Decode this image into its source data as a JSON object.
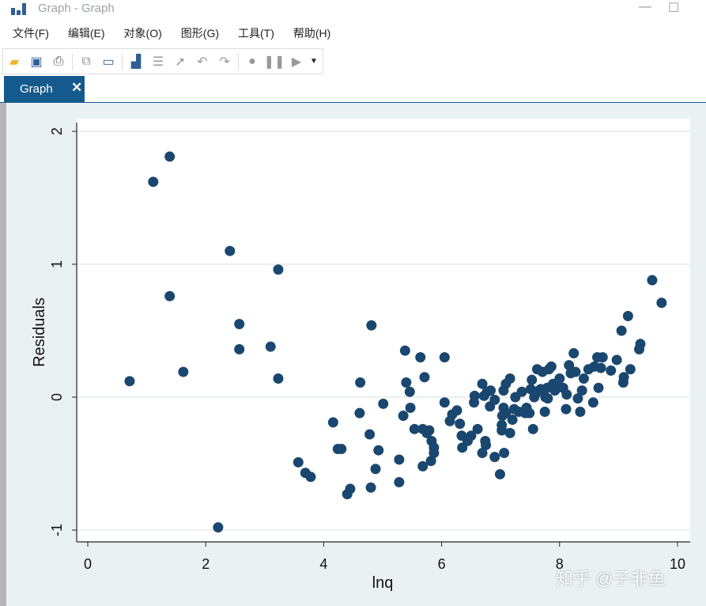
{
  "window": {
    "title": "Graph - Graph"
  },
  "menu": [
    "文件(F)",
    "编辑(E)",
    "对象(O)",
    "图形(G)",
    "工具(T)",
    "帮助(H)"
  ],
  "toolbar_icons": [
    "open-icon",
    "save-icon",
    "print-icon",
    "copy-icon",
    "rename-icon",
    "graph-editor-icon",
    "properties-icon",
    "pointer-icon",
    "undo-icon",
    "redo-icon",
    "record-icon",
    "pause-icon",
    "play-icon",
    "dropdown-icon"
  ],
  "tab": {
    "label": "Graph",
    "close": "✕"
  },
  "watermark": "知乎 @子非鱼",
  "colors": {
    "marker": "#1a476f",
    "plot_bg": "#ffffff",
    "outer_bg": "#eaf1f3",
    "tab": "#145a8c"
  },
  "chart_data": {
    "type": "scatter",
    "xlabel": "lnq",
    "ylabel": "Residuals",
    "xlim": [
      -0.2,
      10.2
    ],
    "ylim": [
      -1.1,
      2.1
    ],
    "xticks": [
      0,
      2,
      4,
      6,
      8,
      10
    ],
    "yticks": [
      -1,
      0,
      1,
      2
    ],
    "grid": "horizontal",
    "points": [
      [
        0.71,
        0.12
      ],
      [
        1.11,
        1.62
      ],
      [
        1.39,
        1.81
      ],
      [
        1.39,
        0.76
      ],
      [
        1.62,
        0.19
      ],
      [
        2.21,
        -0.98
      ],
      [
        2.41,
        1.1
      ],
      [
        2.57,
        0.55
      ],
      [
        2.57,
        0.36
      ],
      [
        3.1,
        0.38
      ],
      [
        3.23,
        0.96
      ],
      [
        3.23,
        0.14
      ],
      [
        3.57,
        -0.49
      ],
      [
        3.69,
        -0.57
      ],
      [
        3.78,
        -0.6
      ],
      [
        4.16,
        -0.19
      ],
      [
        4.24,
        -0.39
      ],
      [
        4.3,
        -0.39
      ],
      [
        4.4,
        -0.73
      ],
      [
        4.45,
        -0.69
      ],
      [
        4.61,
        -0.12
      ],
      [
        4.62,
        0.11
      ],
      [
        4.78,
        -0.28
      ],
      [
        4.8,
        -0.68
      ],
      [
        4.81,
        0.54
      ],
      [
        4.88,
        -0.54
      ],
      [
        4.93,
        -0.4
      ],
      [
        5.01,
        -0.05
      ],
      [
        5.28,
        -0.47
      ],
      [
        5.28,
        -0.64
      ],
      [
        5.35,
        -0.14
      ],
      [
        5.38,
        0.35
      ],
      [
        5.4,
        0.11
      ],
      [
        5.46,
        0.04
      ],
      [
        5.47,
        -0.08
      ],
      [
        5.54,
        -0.24
      ],
      [
        5.64,
        0.3
      ],
      [
        5.68,
        -0.24
      ],
      [
        5.68,
        -0.52
      ],
      [
        5.71,
        0.15
      ],
      [
        5.75,
        -0.27
      ],
      [
        5.79,
        -0.25
      ],
      [
        5.82,
        -0.48
      ],
      [
        5.83,
        -0.33
      ],
      [
        5.87,
        -0.38
      ],
      [
        5.87,
        -0.42
      ],
      [
        6.05,
        0.3
      ],
      [
        6.05,
        -0.04
      ],
      [
        6.14,
        -0.18
      ],
      [
        6.18,
        -0.13
      ],
      [
        6.26,
        -0.1
      ],
      [
        6.31,
        -0.2
      ],
      [
        6.34,
        -0.29
      ],
      [
        6.35,
        -0.38
      ],
      [
        6.44,
        -0.33
      ],
      [
        6.5,
        -0.29
      ],
      [
        6.55,
        -0.04
      ],
      [
        6.56,
        0.01
      ],
      [
        6.61,
        -0.24
      ],
      [
        6.69,
        0.1
      ],
      [
        6.69,
        -0.42
      ],
      [
        6.72,
        0.01
      ],
      [
        6.74,
        -0.33
      ],
      [
        6.75,
        -0.36
      ],
      [
        6.77,
        0.04
      ],
      [
        6.82,
        -0.07
      ],
      [
        6.83,
        0.05
      ],
      [
        6.9,
        -0.45
      ],
      [
        6.9,
        -0.02
      ],
      [
        6.99,
        -0.58
      ],
      [
        7.02,
        -0.25
      ],
      [
        7.02,
        -0.21
      ],
      [
        7.03,
        -0.14
      ],
      [
        7.05,
        -0.08
      ],
      [
        7.06,
        -0.42
      ],
      [
        7.05,
        0.05
      ],
      [
        7.09,
        0.1
      ],
      [
        7.09,
        -0.12
      ],
      [
        7.16,
        -0.27
      ],
      [
        7.16,
        0.14
      ],
      [
        7.2,
        -0.17
      ],
      [
        7.23,
        -0.09
      ],
      [
        7.25,
        0.0
      ],
      [
        7.31,
        -0.11
      ],
      [
        7.36,
        0.04
      ],
      [
        7.42,
        -0.12
      ],
      [
        7.44,
        -0.08
      ],
      [
        7.49,
        -0.12
      ],
      [
        7.51,
        0.06
      ],
      [
        7.53,
        0.13
      ],
      [
        7.55,
        -0.24
      ],
      [
        7.57,
        0.0
      ],
      [
        7.6,
        0.03
      ],
      [
        7.62,
        0.21
      ],
      [
        7.65,
        0.05
      ],
      [
        7.68,
        0.06
      ],
      [
        7.71,
        0.19
      ],
      [
        7.75,
        -0.11
      ],
      [
        7.76,
        0.0
      ],
      [
        7.79,
        0.07
      ],
      [
        7.8,
        -0.01
      ],
      [
        7.82,
        0.21
      ],
      [
        7.86,
        0.23
      ],
      [
        7.89,
        0.1
      ],
      [
        7.92,
        0.05
      ],
      [
        7.96,
        0.1
      ],
      [
        8.0,
        0.14
      ],
      [
        8.06,
        0.07
      ],
      [
        8.11,
        -0.09
      ],
      [
        8.12,
        0.02
      ],
      [
        8.16,
        0.24
      ],
      [
        8.19,
        0.18
      ],
      [
        8.24,
        0.33
      ],
      [
        8.27,
        0.19
      ],
      [
        8.31,
        -0.01
      ],
      [
        8.35,
        -0.11
      ],
      [
        8.38,
        0.05
      ],
      [
        8.41,
        0.14
      ],
      [
        8.49,
        0.21
      ],
      [
        8.57,
        -0.04
      ],
      [
        8.59,
        0.23
      ],
      [
        8.64,
        0.3
      ],
      [
        8.66,
        0.07
      ],
      [
        8.7,
        0.22
      ],
      [
        8.73,
        0.3
      ],
      [
        8.87,
        0.2
      ],
      [
        8.97,
        0.28
      ],
      [
        9.05,
        0.5
      ],
      [
        9.08,
        0.11
      ],
      [
        9.09,
        0.15
      ],
      [
        9.16,
        0.61
      ],
      [
        9.2,
        0.21
      ],
      [
        9.35,
        0.36
      ],
      [
        9.37,
        0.4
      ],
      [
        9.57,
        0.88
      ],
      [
        9.73,
        0.71
      ]
    ]
  }
}
